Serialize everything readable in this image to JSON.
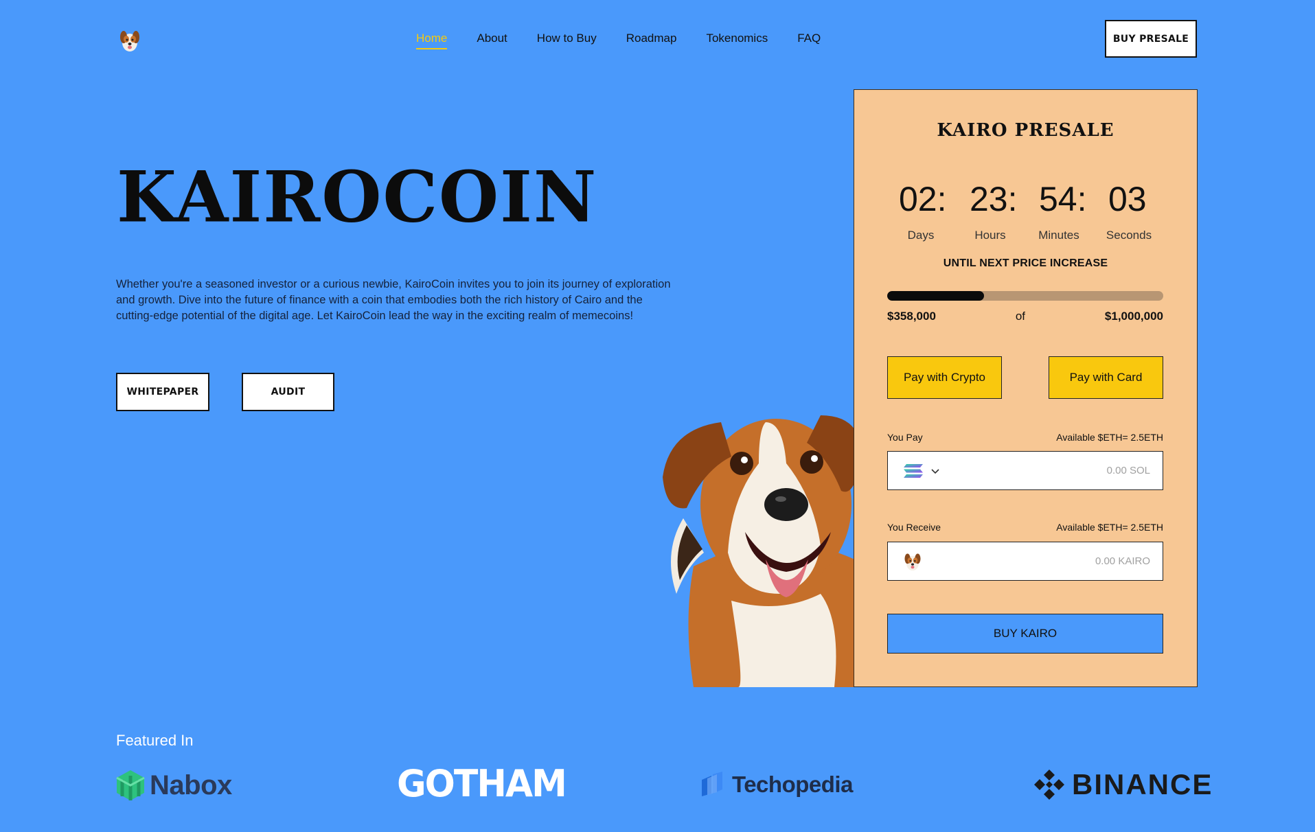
{
  "nav": {
    "items": [
      {
        "label": "Home",
        "active": true
      },
      {
        "label": "About"
      },
      {
        "label": "How to Buy"
      },
      {
        "label": "Roadmap"
      },
      {
        "label": "Tokenomics"
      },
      {
        "label": "FAQ"
      }
    ],
    "cta_label": "BUY PRESALE"
  },
  "hero": {
    "title": "KAIROCOIN",
    "description": "Whether you're a seasoned investor or a curious newbie, KairoCoin invites you to join its journey of exploration and growth. Dive into the future of finance with a coin that embodies both the rich history of Cairo and the cutting-edge potential of the digital age. Let KairoCoin lead the way in the exciting realm of memecoins!",
    "whitepaper_label": "WHITEPAPER",
    "audit_label": "AUDIT"
  },
  "presale": {
    "title": "KAIRO PRESALE",
    "countdown": {
      "days": "02:",
      "hours": "23:",
      "minutes": "54:",
      "seconds": "03",
      "days_label": "Days",
      "hours_label": "Hours",
      "minutes_label": "Minutes",
      "seconds_label": "Seconds"
    },
    "until_text": "UNTIL NEXT PRICE INCREASE",
    "raised": "$358,000",
    "of_text": "of",
    "goal": "$1,000,000",
    "progress_fraction": 0.35,
    "pay_crypto_label": "Pay with Crypto",
    "pay_card_label": "Pay with Card",
    "you_pay_label": "You Pay",
    "you_pay_available": "Available $ETH= 2.5ETH",
    "you_pay_placeholder": "0.00 SOL",
    "you_receive_label": "You Receive",
    "you_receive_available": "Available $ETH= 2.5ETH",
    "you_receive_placeholder": "0.00 KAIRO",
    "buy_label": "BUY KAIRO"
  },
  "featured": {
    "label": "Featured In",
    "brands": [
      "Nabox",
      "GOTHAM",
      "Techopedia",
      "BINANCE"
    ]
  },
  "colors": {
    "background": "#4a99fb",
    "card": "#f7c794",
    "accent_yellow": "#f9c80e",
    "nav_active": "#f6c90e"
  }
}
